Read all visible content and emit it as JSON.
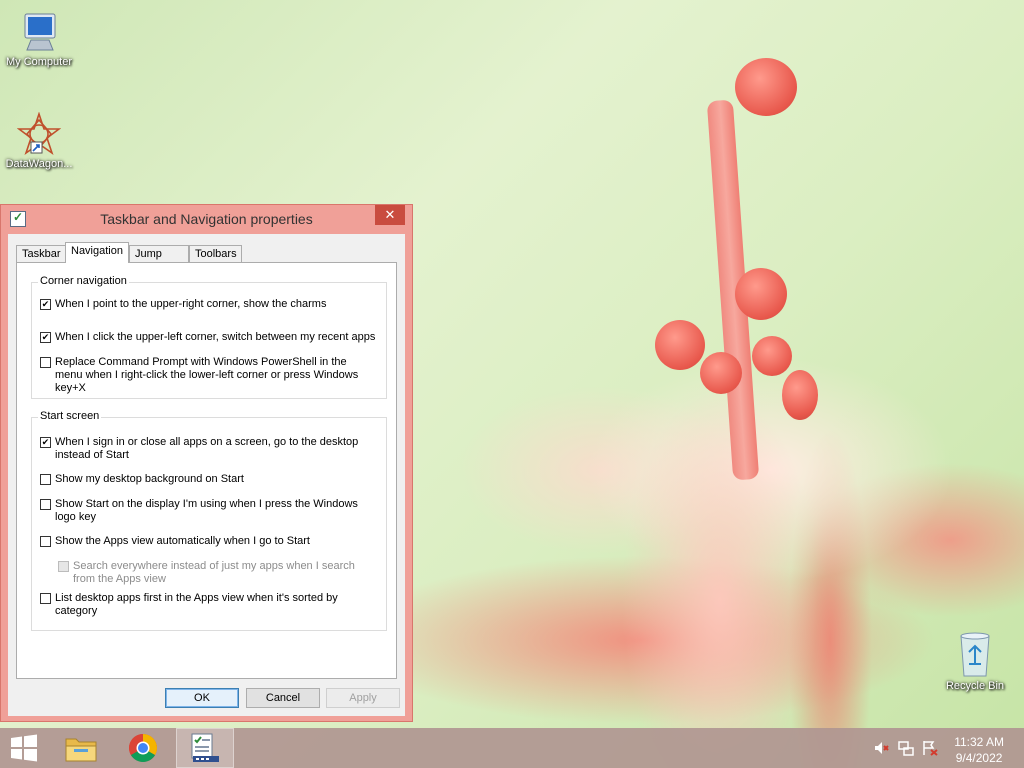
{
  "desktop": {
    "icons": [
      {
        "label": "My Computer",
        "icon": "computer-icon"
      },
      {
        "label": "DataWagon...",
        "icon": "datawagon-shortcut-icon"
      },
      {
        "label": "Recycle Bin",
        "icon": "recycle-bin-icon"
      }
    ]
  },
  "dialog": {
    "title": "Taskbar and Navigation properties",
    "close_symbol": "✕",
    "tabs": [
      {
        "label": "Taskbar",
        "active": false
      },
      {
        "label": "Navigation",
        "active": true
      },
      {
        "label": "Jump Lists",
        "active": false
      },
      {
        "label": "Toolbars",
        "active": false
      }
    ],
    "corner_navigation": {
      "heading": "Corner navigation",
      "options": [
        {
          "label": "When I point to the upper-right corner, show the charms",
          "checked": true
        },
        {
          "label": "When I click the upper-left corner, switch between my recent apps",
          "checked": true
        },
        {
          "label": "Replace Command Prompt with Windows PowerShell in the menu when I right-click the lower-left corner or press Windows key+X",
          "checked": false
        }
      ]
    },
    "start_screen": {
      "heading": "Start screen",
      "options": [
        {
          "label": "When I sign in or close all apps on a screen, go to the desktop instead of Start",
          "checked": true
        },
        {
          "label": "Show my desktop background on Start",
          "checked": false
        },
        {
          "label": "Show Start on the display I'm using when I press the Windows logo key",
          "checked": false
        },
        {
          "label": "Show the Apps view automatically when I go to Start",
          "checked": false
        },
        {
          "label": "Search everywhere instead of just my apps when I search from the Apps view",
          "checked": false,
          "disabled": true
        },
        {
          "label": "List desktop apps first in the Apps view when it's sorted by category",
          "checked": false
        }
      ]
    },
    "buttons": {
      "ok": "OK",
      "cancel": "Cancel",
      "apply": "Apply"
    }
  },
  "taskbar": {
    "items": [
      {
        "name": "start-button",
        "icon": "windows-logo-icon"
      },
      {
        "name": "file-explorer",
        "icon": "folder-icon"
      },
      {
        "name": "chrome",
        "icon": "chrome-icon"
      },
      {
        "name": "taskbar-properties",
        "icon": "taskbar-properties-icon",
        "active": true
      }
    ],
    "tray": {
      "icons": [
        "volume-muted-icon",
        "network-icon",
        "action-center-icon"
      ]
    },
    "clock": {
      "time": "11:32 AM",
      "date": "9/4/2022"
    }
  }
}
